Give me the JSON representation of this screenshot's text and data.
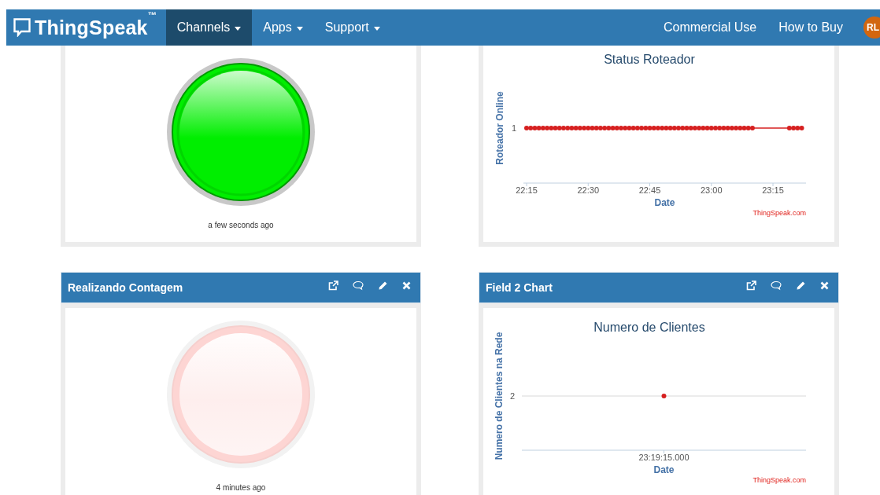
{
  "navbar": {
    "logo": "ThingSpeak",
    "trademark": "™",
    "menus": [
      {
        "label": "Channels",
        "selected": true
      },
      {
        "label": "Apps",
        "selected": false
      },
      {
        "label": "Support",
        "selected": false
      }
    ],
    "links": [
      "Commercial Use",
      "How to Buy"
    ],
    "avatar": "RL"
  },
  "widgets": [
    {
      "kind": "lamp",
      "lit": true,
      "color": "#00ee00",
      "timestamp": "a few seconds ago"
    },
    {
      "kind": "chart",
      "chart_title": "Status Roteador",
      "xlabel": "Date",
      "ylabel": "Roteador Online",
      "xtick_labels": [
        "22:15",
        "22:30",
        "22:45",
        "23:00",
        "23:15"
      ],
      "ytick_label": "1",
      "credit": "ThingSpeak.com"
    },
    {
      "kind": "lamp",
      "title": "Realizando Contagem",
      "lit": false,
      "color": "#fdd5d3",
      "timestamp": "4 minutes ago"
    },
    {
      "kind": "chart",
      "title": "Field 2 Chart",
      "chart_title": "Numero de Clientes",
      "xlabel": "Date",
      "ylabel": "Numero de Clientes na Rede",
      "xtick_labels": [
        "23:19:15.000"
      ],
      "ytick_label": "2",
      "credit": "ThingSpeak.com"
    }
  ]
}
